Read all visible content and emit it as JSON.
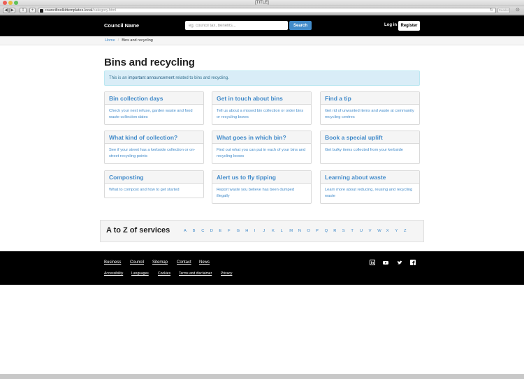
{
  "browser": {
    "window_title": "[TITLE]",
    "url_host": "counciltoolkittemplates.local",
    "url_path": "/category.html",
    "reader_label": "Reader"
  },
  "header": {
    "council_name": "Council Name",
    "search_placeholder": "eg. council tax, benefits...",
    "search_button": "Search",
    "login": "Log in",
    "register": "Register"
  },
  "breadcrumb": {
    "home": "Home",
    "current": "Bins and recycling"
  },
  "page": {
    "title": "Bins and recycling",
    "announcement_prefix": "This is an ",
    "announcement_link": "important announcement",
    "announcement_suffix": " related to bins and recycling."
  },
  "cards": [
    {
      "title": "Bin collection days",
      "body": "Check your next refuse, garden waste and food waste collection dates"
    },
    {
      "title": "Get in touch about bins",
      "body": "Tell us about a missed bin collection or order bins or recycling boxes"
    },
    {
      "title": "Find a tip",
      "body": "Get rid of unwanted items and waste at community recycling centres"
    },
    {
      "title": "What kind of collection?",
      "body": "See if your street has a kerbside collection or on-street recycling points"
    },
    {
      "title": "What goes in which bin?",
      "body": "Find out what you can put in each of your bins and recycling boxes"
    },
    {
      "title": "Book a special uplift",
      "body": "Get bulky items collected from your kerbside"
    },
    {
      "title": "Composting",
      "body": "What to compost and how to get started"
    },
    {
      "title": "Alert us to fly tipping",
      "body": "Report waste you believe has been dumped illegally"
    },
    {
      "title": "Learning about waste",
      "body": "Learn more about reducing, reusing and recycling waste"
    }
  ],
  "atoz": {
    "title": "A to Z of services",
    "letters": [
      "A",
      "B",
      "C",
      "D",
      "E",
      "F",
      "G",
      "H",
      "I",
      "J",
      "K",
      "L",
      "M",
      "N",
      "O",
      "P",
      "Q",
      "R",
      "S",
      "T",
      "U",
      "V",
      "W",
      "X",
      "Y",
      "Z"
    ]
  },
  "footer": {
    "nav": [
      "Business",
      "Council",
      "Sitemap",
      "Contact",
      "News"
    ],
    "sub": [
      "Accessibility",
      "Languages",
      "Cookies",
      "Terms and disclaimer",
      "Privacy"
    ],
    "social_icons": [
      "linkedin-icon",
      "youtube-icon",
      "twitter-icon",
      "facebook-icon"
    ]
  }
}
